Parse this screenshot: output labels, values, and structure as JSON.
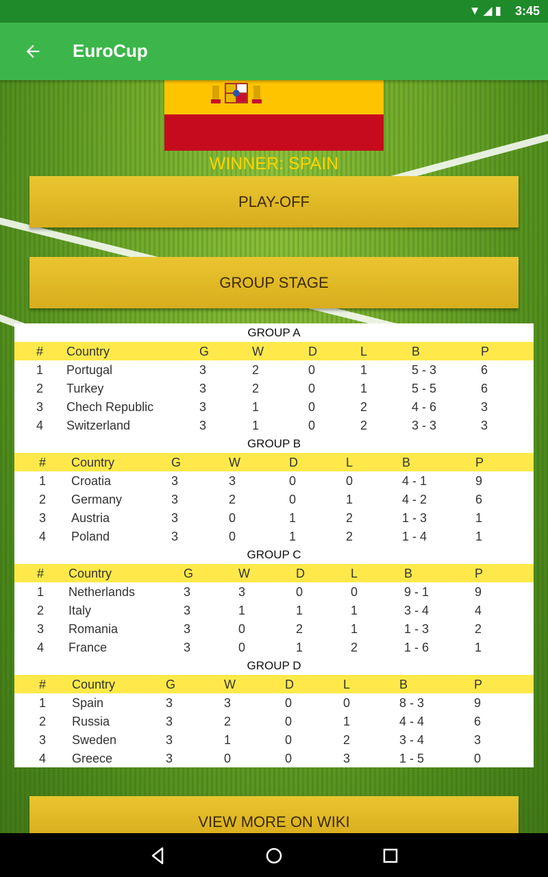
{
  "status_bar": {
    "time": "3:45",
    "icons": "wifi-icon signal-icon battery-icon"
  },
  "app_bar": {
    "title": "EuroCup",
    "back_icon": "arrow-left-icon"
  },
  "winner_label": "WINNER: SPAIN",
  "buttons": {
    "playoff": "PLAY-OFF",
    "group_stage": "GROUP STAGE",
    "wiki": "VIEW MORE ON WIKI"
  },
  "table_headers": [
    "#",
    "Country",
    "G",
    "W",
    "D",
    "L",
    "B",
    "P"
  ],
  "groups": [
    {
      "title": "GROUP A",
      "rows": [
        [
          "1",
          "Portugal",
          "3",
          "2",
          "0",
          "1",
          "5 - 3",
          "6"
        ],
        [
          "2",
          "Turkey",
          "3",
          "2",
          "0",
          "1",
          "5 - 5",
          "6"
        ],
        [
          "3",
          "Chech Republic",
          "3",
          "1",
          "0",
          "2",
          "4 - 6",
          "3"
        ],
        [
          "4",
          "Switzerland",
          "3",
          "1",
          "0",
          "2",
          "3 - 3",
          "3"
        ]
      ]
    },
    {
      "title": "GROUP B",
      "rows": [
        [
          "1",
          "Croatia",
          "3",
          "3",
          "0",
          "0",
          "4 - 1",
          "9"
        ],
        [
          "2",
          "Germany",
          "3",
          "2",
          "0",
          "1",
          "4 - 2",
          "6"
        ],
        [
          "3",
          "Austria",
          "3",
          "0",
          "1",
          "2",
          "1 - 3",
          "1"
        ],
        [
          "4",
          "Poland",
          "3",
          "0",
          "1",
          "2",
          "1 - 4",
          "1"
        ]
      ]
    },
    {
      "title": "GROUP C",
      "rows": [
        [
          "1",
          "Netherlands",
          "3",
          "3",
          "0",
          "0",
          "9 - 1",
          "9"
        ],
        [
          "2",
          "Italy",
          "3",
          "1",
          "1",
          "1",
          "3 - 4",
          "4"
        ],
        [
          "3",
          "Romania",
          "3",
          "0",
          "2",
          "1",
          "1 - 3",
          "2"
        ],
        [
          "4",
          "France",
          "3",
          "0",
          "1",
          "2",
          "1 - 6",
          "1"
        ]
      ]
    },
    {
      "title": "GROUP D",
      "rows": [
        [
          "1",
          "Spain",
          "3",
          "3",
          "0",
          "0",
          "8 - 3",
          "9"
        ],
        [
          "2",
          "Russia",
          "3",
          "2",
          "0",
          "1",
          "4 - 4",
          "6"
        ],
        [
          "3",
          "Sweden",
          "3",
          "1",
          "0",
          "2",
          "3 - 4",
          "3"
        ],
        [
          "4",
          "Greece",
          "3",
          "0",
          "0",
          "3",
          "1 - 5",
          "0"
        ]
      ]
    }
  ],
  "colors": {
    "app_bar": "#3cb64a",
    "status_bar": "#1f8a2a",
    "header_row": "#ffe94a",
    "winner_text": "#ffd400",
    "button": "#e0b926"
  }
}
